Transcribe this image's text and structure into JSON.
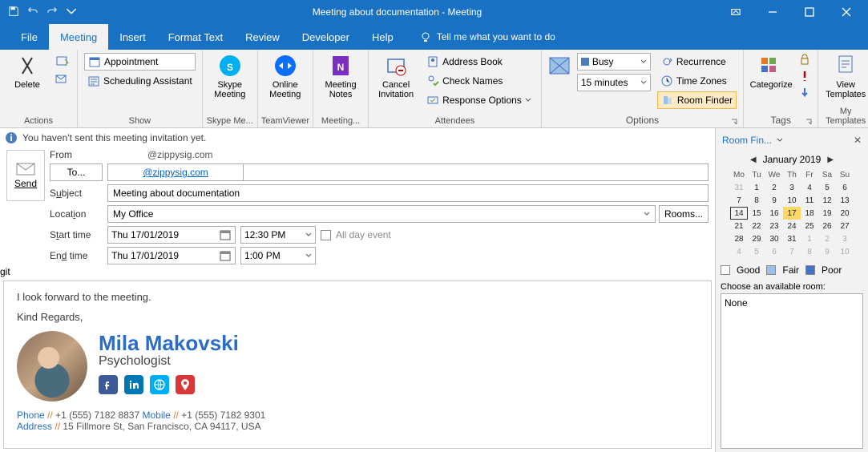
{
  "window": {
    "title": "Meeting about documentation  -  Meeting"
  },
  "menu": {
    "file": "File",
    "meeting": "Meeting",
    "insert": "Insert",
    "format": "Format Text",
    "review": "Review",
    "developer": "Developer",
    "help": "Help",
    "tellme": "Tell me what you want to do"
  },
  "ribbon": {
    "actions": {
      "label": "Actions",
      "delete": "Delete"
    },
    "show": {
      "label": "Show",
      "appointment": "Appointment",
      "scheduling": "Scheduling Assistant"
    },
    "skype": {
      "label": "Skype Me...",
      "btn": "Skype\nMeeting"
    },
    "teamviewer": {
      "label": "TeamViewer",
      "btn": "Online\nMeeting"
    },
    "notes": {
      "label": "Meeting...",
      "btn": "Meeting\nNotes"
    },
    "attendees": {
      "label": "Attendees",
      "cancel": "Cancel\nInvitation",
      "address": "Address Book",
      "check": "Check Names",
      "response": "Response Options"
    },
    "options": {
      "label": "Options",
      "busy": "Busy",
      "reminder": "15 minutes",
      "recurrence": "Recurrence",
      "timezones": "Time Zones",
      "roomfinder": "Room Finder"
    },
    "tags": {
      "label": "Tags",
      "categorize": "Categorize"
    },
    "templates": {
      "label": "My Templates",
      "btn": "View\nTemplates"
    }
  },
  "info": {
    "text": "You haven't sent this meeting invitation yet."
  },
  "form": {
    "send": "Send",
    "from_label": "From",
    "from_value": "@zippysig.com",
    "to_label": "To...",
    "to_value": "@zippysig.com",
    "subject_label": "Subject",
    "subject_value": "Meeting about documentation",
    "location_label": "Location",
    "location_value": "My Office",
    "rooms": "Rooms...",
    "start_label": "Start time",
    "end_label": "End time",
    "start_date": "Thu 17/01/2019",
    "start_time": "12:30 PM",
    "end_date": "Thu 17/01/2019",
    "end_time": "1:00 PM",
    "allday": "All day event"
  },
  "body": {
    "line1": "I look forward to the meeting.",
    "line2": "Kind Regards,",
    "sig_name": "Mila Makovski",
    "sig_title": "Psychologist",
    "phone_k": "Phone",
    "phone_v": "+1 (555) 7182 8837",
    "mobile_k": "Mobile",
    "mobile_v": "+1 (555) 7182 9301",
    "address_k": "Address",
    "address_v": "15 Fillmore St, San Francisco, CA 94117, USA"
  },
  "side": {
    "title": "Room Fin...",
    "month": "January 2019",
    "days": [
      "Mo",
      "Tu",
      "We",
      "Th",
      "Fr",
      "Sa",
      "Su"
    ],
    "weeks": [
      [
        {
          "d": "31",
          "off": true
        },
        {
          "d": "1"
        },
        {
          "d": "2"
        },
        {
          "d": "3"
        },
        {
          "d": "4"
        },
        {
          "d": "5"
        },
        {
          "d": "6"
        }
      ],
      [
        {
          "d": "7"
        },
        {
          "d": "8"
        },
        {
          "d": "9"
        },
        {
          "d": "10"
        },
        {
          "d": "11"
        },
        {
          "d": "12"
        },
        {
          "d": "13"
        }
      ],
      [
        {
          "d": "14",
          "today": true
        },
        {
          "d": "15"
        },
        {
          "d": "16"
        },
        {
          "d": "17",
          "sel": true
        },
        {
          "d": "18"
        },
        {
          "d": "19"
        },
        {
          "d": "20"
        }
      ],
      [
        {
          "d": "21"
        },
        {
          "d": "22"
        },
        {
          "d": "23"
        },
        {
          "d": "24"
        },
        {
          "d": "25"
        },
        {
          "d": "26"
        },
        {
          "d": "27"
        }
      ],
      [
        {
          "d": "28"
        },
        {
          "d": "29"
        },
        {
          "d": "30"
        },
        {
          "d": "31"
        },
        {
          "d": "1",
          "off": true
        },
        {
          "d": "2",
          "off": true
        },
        {
          "d": "3",
          "off": true
        }
      ],
      [
        {
          "d": "4",
          "off": true
        },
        {
          "d": "5",
          "off": true
        },
        {
          "d": "6",
          "off": true
        },
        {
          "d": "7",
          "off": true
        },
        {
          "d": "8",
          "off": true
        },
        {
          "d": "9",
          "off": true
        },
        {
          "d": "10",
          "off": true
        }
      ]
    ],
    "good": "Good",
    "fair": "Fair",
    "poor": "Poor",
    "choose": "Choose an available room:",
    "none": "None"
  }
}
